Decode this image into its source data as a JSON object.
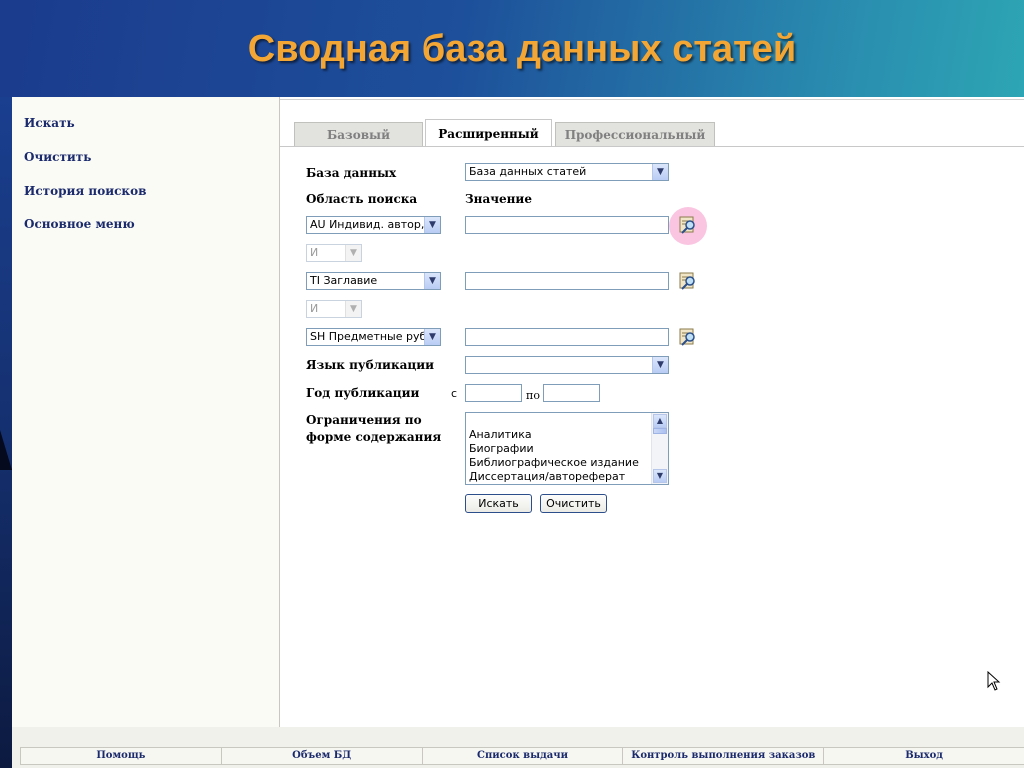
{
  "slide": {
    "title": "Сводная база данных статей"
  },
  "sidebar": {
    "items": [
      {
        "label": "Искать"
      },
      {
        "label": "Очистить"
      },
      {
        "label": "История поисков"
      },
      {
        "label": "Основное меню"
      }
    ]
  },
  "tabs": [
    {
      "label": "Базовый",
      "active": false
    },
    {
      "label": "Расширенный",
      "active": true
    },
    {
      "label": "Профессиональный",
      "active": false
    }
  ],
  "form": {
    "database_label": "База данных",
    "database_value": "База данных статей",
    "search_area_label": "Область поиска",
    "value_label": "Значение",
    "rows": [
      {
        "field": "AU Индивид. автор, р",
        "value": ""
      },
      {
        "field": "TI Заглавие",
        "value": ""
      },
      {
        "field": "SH Предметные рубр",
        "value": ""
      }
    ],
    "operators": [
      "И",
      "И"
    ],
    "language_label": "Язык публикации",
    "language_value": "",
    "year_label": "Год публикации",
    "year_from_label": "с",
    "year_to_label": "по",
    "year_from": "",
    "year_to": "",
    "content_limit_label_1": "Ограничения по",
    "content_limit_label_2": "форме содержания",
    "content_options": [
      "Аналитика",
      "Биографии",
      "Библиографическое издание",
      "Диссертация/автореферат"
    ],
    "search_button": "Искать",
    "clear_button": "Очистить"
  },
  "footer": {
    "items": [
      "Помощь",
      "Объем БД",
      "Список выдачи",
      "Контроль выполнения заказов",
      "Выход"
    ]
  },
  "colors": {
    "title": "#f4a634",
    "link": "#1a2a6c",
    "halo": "#f596c8"
  },
  "icons": [
    "lookup-icon",
    "dropdown-arrow-icon",
    "scroll-up-icon",
    "scroll-down-icon",
    "mouse-cursor-icon"
  ]
}
